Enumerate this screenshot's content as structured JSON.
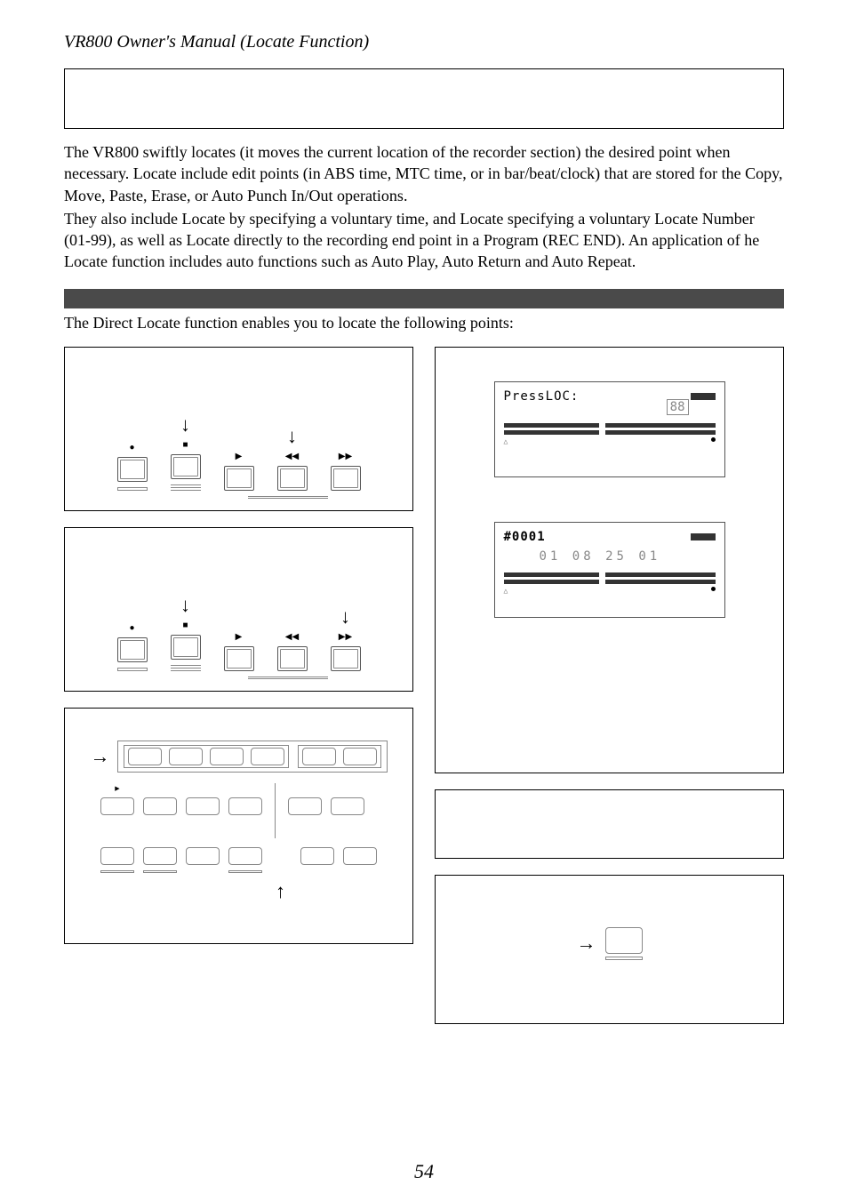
{
  "header": "VR800 Owner's Manual (Locate Function)",
  "intro": {
    "p1": "The VR800 swiftly locates (it moves the current location of the recorder section) the desired point when necessary. Locate include edit points (in ABS time, MTC time, or in bar/beat/clock) that are stored for the Copy, Move, Paste, Erase, or Auto Punch In/Out operations.",
    "p2": "They also include Locate by specifying a voluntary time, and Locate specifying a voluntary Locate Number (01-99), as well as Locate directly to the recording end point in a Program (REC END).  An application of he Locate function includes auto functions such as Auto Play, Auto Return and Auto Repeat."
  },
  "sub_intro": "The Direct Locate function enables you to locate the following points:",
  "lcd1": {
    "label": "PressLOC:",
    "box": "88"
  },
  "lcd2": {
    "label": "#0001",
    "time": "01 08 25 01"
  },
  "transport_icons": {
    "rec": "●",
    "stop": "■",
    "play": "▶",
    "rew": "◀◀",
    "ff": "▶▶"
  },
  "page_number": "54"
}
